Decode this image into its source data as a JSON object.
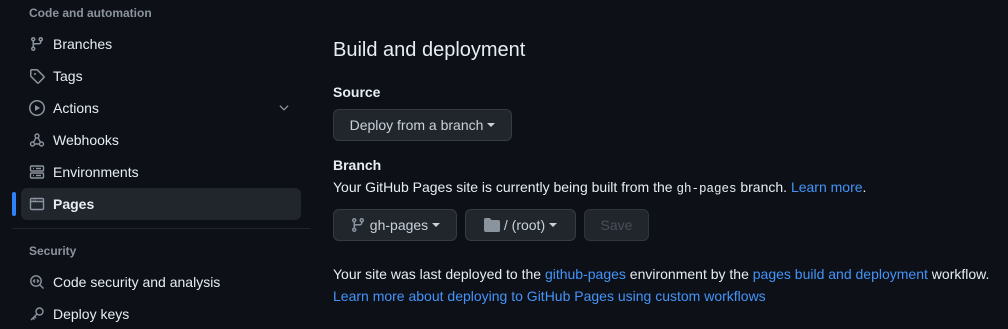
{
  "sidebar": {
    "section_code": "Code and automation",
    "section_security": "Security",
    "items": [
      {
        "label": "Branches",
        "icon": "branch-icon"
      },
      {
        "label": "Tags",
        "icon": "tag-icon"
      },
      {
        "label": "Actions",
        "icon": "play-icon"
      },
      {
        "label": "Webhooks",
        "icon": "webhook-icon"
      },
      {
        "label": "Environments",
        "icon": "server-icon"
      },
      {
        "label": "Pages",
        "icon": "browser-icon",
        "active": true
      }
    ],
    "security_items": [
      {
        "label": "Code security and analysis",
        "icon": "codescan-icon"
      },
      {
        "label": "Deploy keys",
        "icon": "key-icon"
      }
    ]
  },
  "main": {
    "title": "Build and deployment",
    "source": {
      "label": "Source",
      "button": "Deploy from a branch"
    },
    "branch": {
      "label": "Branch",
      "desc_prefix": "Your GitHub Pages site is currently being built from the",
      "desc_code": "gh-pages",
      "desc_suffix": "branch.",
      "learn_more": "Learn more",
      "learn_more_suffix": ".",
      "branch_button": "gh-pages",
      "folder_button": "/ (root)",
      "save_button": "Save"
    },
    "deploy": {
      "prefix": "Your site was last deployed to the",
      "env_link": "github-pages",
      "middle": "environment by the",
      "workflow_link": "pages build and deployment",
      "suffix": "workflow.",
      "custom_link": "Learn more about deploying to GitHub Pages using custom workflows"
    }
  },
  "colors": {
    "background": "#0d1117",
    "accent": "#2f81f7",
    "link": "#4493f8",
    "muted": "#8b949e"
  }
}
